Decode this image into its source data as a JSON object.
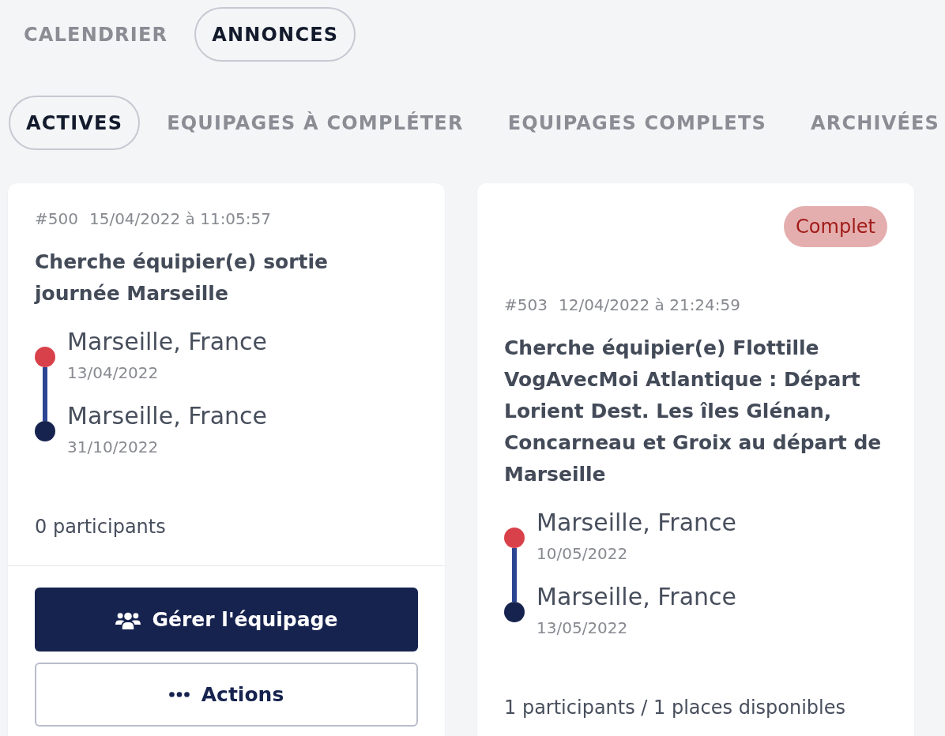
{
  "nav_tabs": [
    {
      "label": "CALENDRIER",
      "selected": false
    },
    {
      "label": "ANNONCES",
      "selected": true
    }
  ],
  "filter_tabs": [
    {
      "label": "ACTIVES",
      "selected": true
    },
    {
      "label": "EQUIPAGES À COMPLÉTER",
      "selected": false
    },
    {
      "label": "EQUIPAGES COMPLETS",
      "selected": false
    },
    {
      "label": "ARCHIVÉES",
      "selected": false
    }
  ],
  "cards": [
    {
      "number": "#500",
      "posted": "15/04/2022 à 11:05:57",
      "title": "Cherche équipier(e) sortie journée Marseille",
      "stops": [
        {
          "kind": "departure",
          "place": "Marseille, France",
          "date": "13/04/2022"
        },
        {
          "kind": "arrival",
          "place": "Marseille, France",
          "date": "31/10/2022"
        }
      ],
      "participants": "0 participants",
      "buttons": [
        {
          "kind": "primary",
          "label": "Gérer l'équipage"
        },
        {
          "kind": "secondary",
          "label": "Actions"
        }
      ]
    },
    {
      "badge": "Complet",
      "number": "#503",
      "posted": "12/04/2022 à 21:24:59",
      "title": "Cherche équipier(e) Flottille VogAvecMoi Atlantique : Départ Lorient Dest. Les îles Glénan, Concarneau et Groix au départ de Marseille",
      "stops": [
        {
          "kind": "departure",
          "place": "Marseille, France",
          "date": "10/05/2022"
        },
        {
          "kind": "arrival",
          "place": "Marseille, France",
          "date": "13/05/2022"
        }
      ],
      "participants": "1 participants / 1 places disponibles"
    }
  ]
}
